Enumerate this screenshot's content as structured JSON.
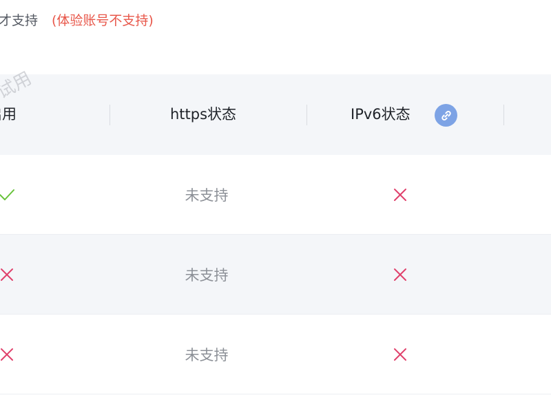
{
  "notice": {
    "prefix": "才支持",
    "warning": "(体验账号不支持)"
  },
  "watermark": "试用",
  "table": {
    "columns": [
      {
        "label": "启用"
      },
      {
        "label": "https状态"
      },
      {
        "label": "IPv6状态",
        "icon": "link-icon"
      }
    ],
    "rows": [
      {
        "enabled": "check-icon",
        "https": "未支持",
        "ipv6": "cross-icon"
      },
      {
        "enabled": "cross-icon",
        "https": "未支持",
        "ipv6": "cross-icon"
      },
      {
        "enabled": "cross-icon",
        "https": "未支持",
        "ipv6": "cross-icon"
      }
    ]
  },
  "colors": {
    "check": "#67c23a",
    "cross": "#e0406b",
    "warning": "#e8574a",
    "header_bg": "#f4f6f9",
    "link_icon_bg": "#7da3e5"
  }
}
